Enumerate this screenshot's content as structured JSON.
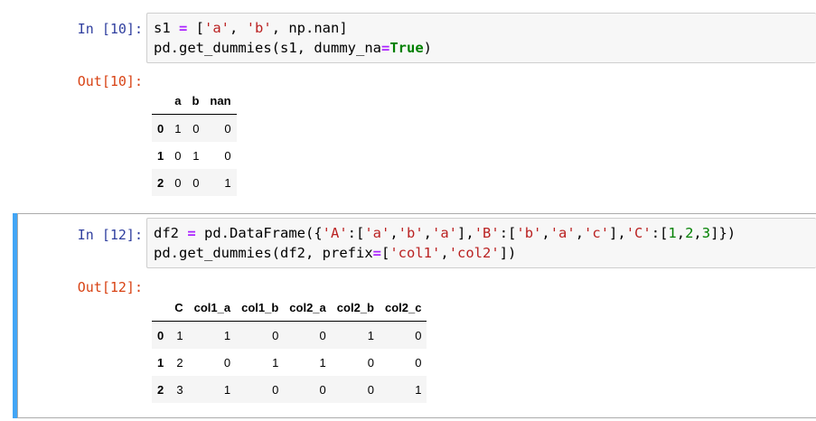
{
  "cell1": {
    "in_prompt": "In [10]:",
    "out_prompt": "Out[10]:",
    "code_lines": [
      [
        [
          "t-var",
          "s1 "
        ],
        [
          "t-op",
          "="
        ],
        [
          "t-var",
          " ["
        ],
        [
          "t-str",
          "'a'"
        ],
        [
          "t-var",
          ", "
        ],
        [
          "t-str",
          "'b'"
        ],
        [
          "t-var",
          ", np.nan]"
        ]
      ],
      [
        [
          "t-var",
          "pd.get_dummies"
        ],
        [
          "t-paren",
          "("
        ],
        [
          "t-var",
          "s1, dummy_na"
        ],
        [
          "t-op",
          "="
        ],
        [
          "t-kw",
          "True"
        ],
        [
          "t-paren",
          ")"
        ]
      ]
    ],
    "table": {
      "columns": [
        "",
        "a",
        "b",
        "nan"
      ],
      "rows": [
        [
          "0",
          "1",
          "0",
          "0"
        ],
        [
          "1",
          "0",
          "1",
          "0"
        ],
        [
          "2",
          "0",
          "0",
          "1"
        ]
      ]
    }
  },
  "cell2": {
    "in_prompt": "In [12]:",
    "out_prompt": "Out[12]:",
    "code_lines": [
      [
        [
          "t-var",
          "df2 "
        ],
        [
          "t-op",
          "="
        ],
        [
          "t-var",
          " pd.DataFrame({"
        ],
        [
          "t-str",
          "'A'"
        ],
        [
          "t-var",
          ":["
        ],
        [
          "t-str",
          "'a'"
        ],
        [
          "t-var",
          ","
        ],
        [
          "t-str",
          "'b'"
        ],
        [
          "t-var",
          ","
        ],
        [
          "t-str",
          "'a'"
        ],
        [
          "t-var",
          "],"
        ],
        [
          "t-str",
          "'B'"
        ],
        [
          "t-var",
          ":["
        ],
        [
          "t-str",
          "'b'"
        ],
        [
          "t-var",
          ","
        ],
        [
          "t-str",
          "'a'"
        ],
        [
          "t-var",
          ","
        ],
        [
          "t-str",
          "'c'"
        ],
        [
          "t-var",
          "],"
        ],
        [
          "t-str",
          "'C'"
        ],
        [
          "t-var",
          ":["
        ],
        [
          "t-num",
          "1"
        ],
        [
          "t-var",
          ","
        ],
        [
          "t-num",
          "2"
        ],
        [
          "t-var",
          ","
        ],
        [
          "t-num",
          "3"
        ],
        [
          "t-var",
          "]})"
        ]
      ],
      [
        [
          "t-var",
          "pd.get_dummies"
        ],
        [
          "t-paren",
          "("
        ],
        [
          "t-var",
          "df2, prefix"
        ],
        [
          "t-op",
          "="
        ],
        [
          "t-var",
          "["
        ],
        [
          "t-str",
          "'col1'"
        ],
        [
          "t-var",
          ","
        ],
        [
          "t-str",
          "'col2'"
        ],
        [
          "t-var",
          "]"
        ],
        [
          "t-paren",
          ")"
        ]
      ]
    ],
    "table": {
      "columns": [
        "",
        "C",
        "col1_a",
        "col1_b",
        "col2_a",
        "col2_b",
        "col2_c"
      ],
      "rows": [
        [
          "0",
          "1",
          "1",
          "0",
          "0",
          "1",
          "0"
        ],
        [
          "1",
          "2",
          "0",
          "1",
          "1",
          "0",
          "0"
        ],
        [
          "2",
          "3",
          "1",
          "0",
          "0",
          "0",
          "1"
        ]
      ]
    }
  },
  "colors": {
    "in_prompt": "#303f9f",
    "out_prompt": "#d84315",
    "selected_bar": "#42a5f5",
    "string": "#ba2121",
    "keyword": "#008000",
    "operator": "#aa22ff"
  }
}
